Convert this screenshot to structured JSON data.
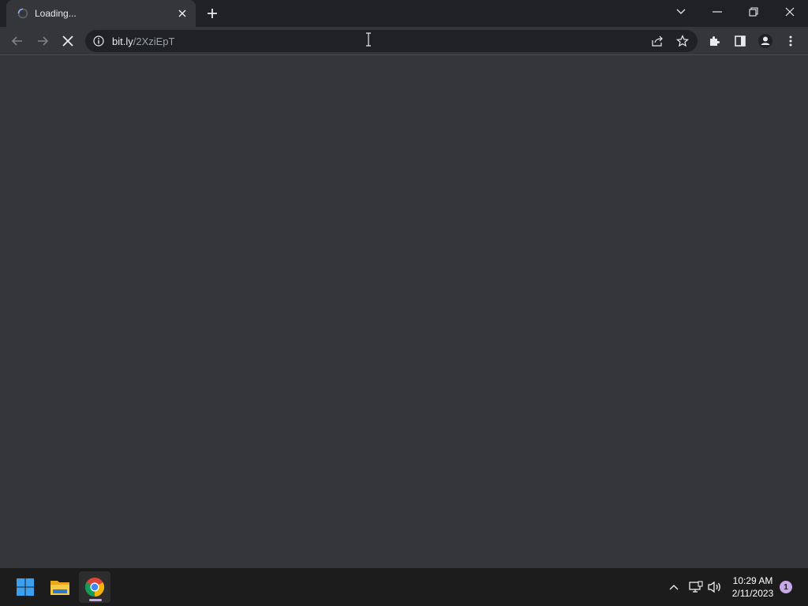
{
  "browser": {
    "tab": {
      "title": "Loading...",
      "state": "loading"
    },
    "address_bar": {
      "host": "bit.ly",
      "path": "/2XziEpT"
    },
    "toolbar_icons": [
      "back-icon",
      "forward-icon",
      "stop-icon",
      "info-icon",
      "share-icon",
      "bookmark-star-icon",
      "extensions-icon",
      "side-panel-icon",
      "profile-icon",
      "menu-icon"
    ],
    "window_controls": [
      "tab-search-icon",
      "minimize-icon",
      "restore-icon",
      "close-icon"
    ]
  },
  "taskbar": {
    "apps": [
      "windows-start",
      "file-explorer",
      "google-chrome"
    ],
    "active_app": "google-chrome",
    "clock": {
      "time": "10:29 AM",
      "date": "2/11/2023"
    },
    "notification_count": "1"
  },
  "colors": {
    "tabstrip_bg": "#202124",
    "toolbar_bg": "#35363a",
    "omnibox_bg": "#202124",
    "taskbar_bg": "#1c1c1c",
    "accent": "#c8a8e8"
  }
}
